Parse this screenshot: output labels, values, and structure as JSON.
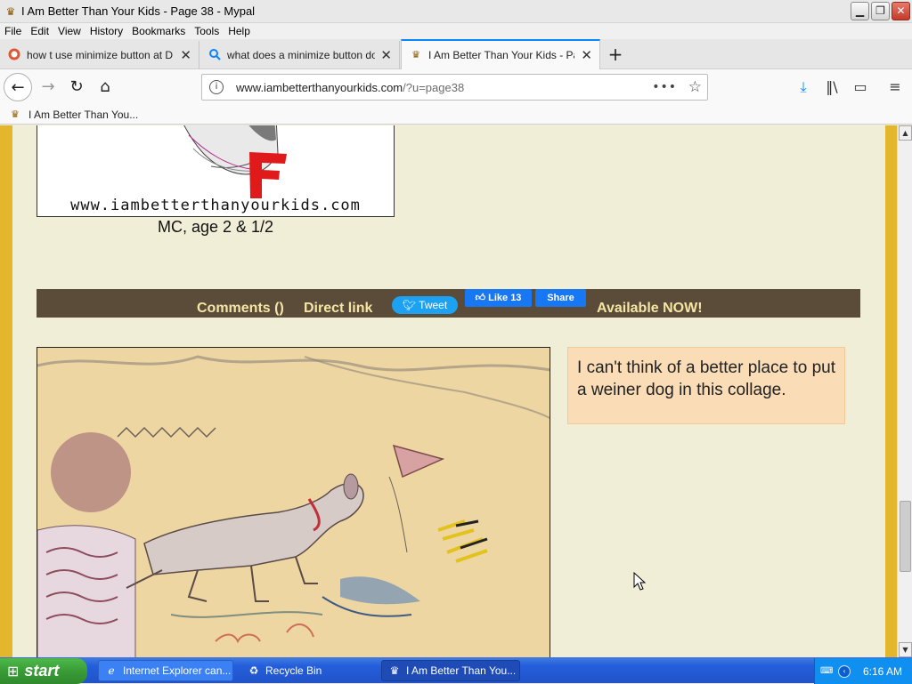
{
  "window": {
    "title": "I Am Better Than Your Kids - Page 38 - Mypal",
    "minimize": "▁",
    "restore": "❐",
    "close": "✕"
  },
  "menu": {
    "items": [
      "File",
      "Edit",
      "View",
      "History",
      "Bookmarks",
      "Tools",
      "Help"
    ]
  },
  "tabs": [
    {
      "label": "how t use minimize button at Duck",
      "icon": "duckduckgo-icon",
      "close": "✕"
    },
    {
      "label": "what does a minimize button do - ",
      "icon": "search-icon",
      "close": "✕"
    },
    {
      "label": "I Am Better Than Your Kids - Page",
      "icon": "crown-icon",
      "close": "✕"
    }
  ],
  "new_tab": "+",
  "nav": {
    "back": "←",
    "forward": "→",
    "reload": "↻",
    "home": "⌂",
    "url_host": "www.iambetterthanyourkids.com",
    "url_path": "/?u=page38",
    "page_actions": "•••",
    "bookmark_star": "☆",
    "download": "⤓",
    "library": "‖\\",
    "sidebar": "▭",
    "menu": "≡"
  },
  "bookmarks": {
    "items": [
      {
        "label": "I Am Better Than You...",
        "icon": "crown-icon"
      }
    ]
  },
  "page": {
    "top_comic": {
      "site_url": "www.iambetterthanyourkids.com",
      "grade": "F",
      "caption": "MC, age 2 & 1/2"
    },
    "comment_bar": {
      "comments": "Comments ()",
      "direct_link": "Direct link",
      "tweet": "Tweet",
      "like": "Like 13",
      "share": "Share",
      "available": "Available NOW!"
    },
    "quote": "I can't think of a better place to put a weiner dog in this collage."
  },
  "scrollbar": {
    "up": "▲",
    "down": "▼"
  },
  "taskbar": {
    "start": "start",
    "items": [
      {
        "label": "Internet Explorer can...",
        "icon": "ie-icon"
      },
      {
        "label": "Recycle Bin",
        "icon": "recycle-bin-icon"
      },
      {
        "label": "I Am Better Than You...",
        "icon": "crown-icon"
      }
    ],
    "clock": "6:16 AM"
  }
}
